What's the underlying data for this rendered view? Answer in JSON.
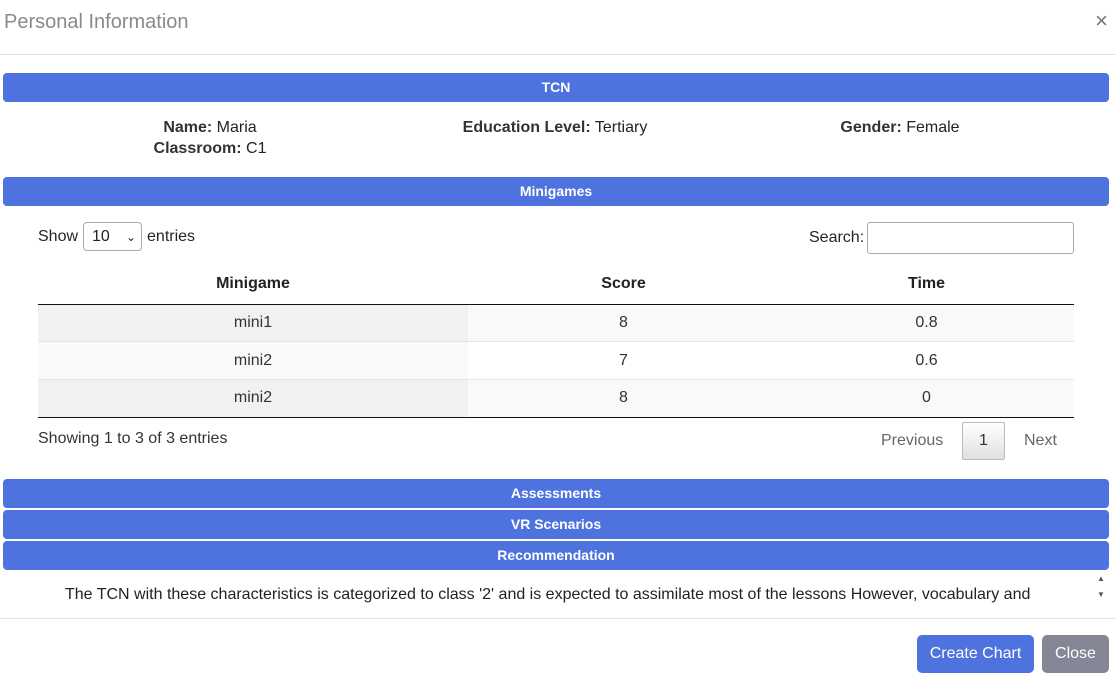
{
  "modal": {
    "title": "Personal Information",
    "close_glyph": "×"
  },
  "sections": {
    "tcn": "TCN",
    "minigames": "Minigames",
    "assessments": "Assessments",
    "vr": "VR Scenarios",
    "recommendation": "Recommendation"
  },
  "profile": {
    "name_label": "Name:",
    "name": "Maria",
    "classroom_label": "Classroom:",
    "classroom": "C1",
    "education_label": "Education Level:",
    "education": "Tertiary",
    "gender_label": "Gender:",
    "gender": "Female"
  },
  "table_controls": {
    "show_label": "Show",
    "entries_label": "entries",
    "page_size": "10",
    "search_label": "Search:",
    "search_value": "",
    "search_placeholder": ""
  },
  "table": {
    "headers": [
      "Minigame",
      "Score",
      "Time"
    ],
    "rows": [
      [
        "mini1",
        "8",
        "0.8"
      ],
      [
        "mini2",
        "7",
        "0.6"
      ],
      [
        "mini2",
        "8",
        "0"
      ]
    ]
  },
  "pagination": {
    "info": "Showing 1 to 3 of 3 entries",
    "previous": "Previous",
    "page": "1",
    "next": "Next"
  },
  "recommendation_text": "The TCN with these characteristics is categorized to class '2' and is expected to assimilate most of the lessons However, vocabulary and",
  "footer": {
    "create_chart": "Create Chart",
    "close": "Close"
  },
  "colors": {
    "accent": "#4e73df",
    "secondary": "#858796"
  }
}
